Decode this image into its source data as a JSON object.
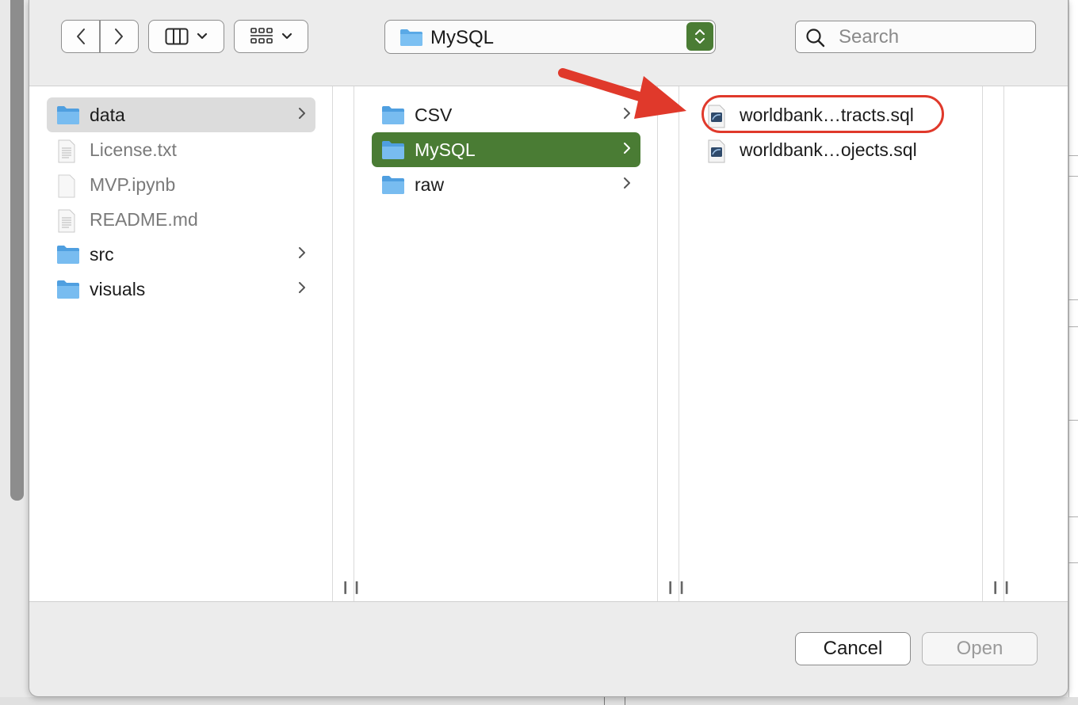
{
  "toolbar": {
    "back_icon": "chevron-left-icon",
    "forward_icon": "chevron-right-icon",
    "view_icon": "column-view-icon",
    "group_icon": "group-grid-icon",
    "path_label": "MySQL",
    "search_placeholder": "Search"
  },
  "columns": [
    {
      "items": [
        {
          "label": "data",
          "kind": "folder",
          "has_children": true,
          "state": "selected-inactive"
        },
        {
          "label": "License.txt",
          "kind": "text-file",
          "has_children": false,
          "state": "disabled"
        },
        {
          "label": "MVP.ipynb",
          "kind": "file",
          "has_children": false,
          "state": "disabled"
        },
        {
          "label": "README.md",
          "kind": "text-file",
          "has_children": false,
          "state": "disabled"
        },
        {
          "label": "src",
          "kind": "folder",
          "has_children": true,
          "state": "normal"
        },
        {
          "label": "visuals",
          "kind": "folder",
          "has_children": true,
          "state": "normal"
        }
      ]
    },
    {
      "items": [
        {
          "label": "CSV",
          "kind": "folder",
          "has_children": true,
          "state": "normal"
        },
        {
          "label": "MySQL",
          "kind": "folder",
          "has_children": true,
          "state": "selected-active"
        },
        {
          "label": "raw",
          "kind": "folder",
          "has_children": true,
          "state": "normal"
        }
      ]
    },
    {
      "items": [
        {
          "label": "worldbank…tracts.sql",
          "kind": "sql-file",
          "has_children": false,
          "state": "highlighted"
        },
        {
          "label": "worldbank…ojects.sql",
          "kind": "sql-file",
          "has_children": false,
          "state": "normal"
        }
      ]
    }
  ],
  "footer": {
    "cancel_label": "Cancel",
    "open_label": "Open"
  },
  "colors": {
    "accent_green": "#4a7c34",
    "annotation_red": "#e0392b",
    "folder_blue": "#5aa9e6"
  }
}
